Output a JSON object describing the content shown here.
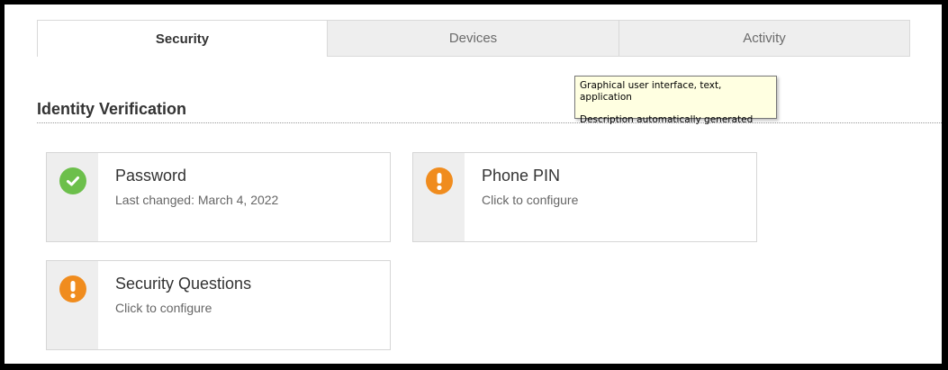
{
  "tabs": [
    {
      "label": "Security",
      "active": true
    },
    {
      "label": "Devices",
      "active": false
    },
    {
      "label": "Activity",
      "active": false
    }
  ],
  "section": {
    "title": "Identity Verification"
  },
  "tooltip": {
    "line1": "Graphical user interface, text, application",
    "line2": "Description automatically generated"
  },
  "cards": [
    {
      "title": "Password",
      "subtitle": "Last changed: March 4, 2022",
      "status": "check-circle-icon"
    },
    {
      "title": "Phone PIN",
      "subtitle": "Click to configure",
      "status": "warning-circle-icon"
    },
    {
      "title": "Security Questions",
      "subtitle": "Click to configure",
      "status": "warning-circle-icon"
    }
  ],
  "colors": {
    "ok": "#6cbf4b",
    "warning": "#f08c1e",
    "tab_inactive_bg": "#eeeeee",
    "tooltip_bg": "#ffffe1"
  }
}
